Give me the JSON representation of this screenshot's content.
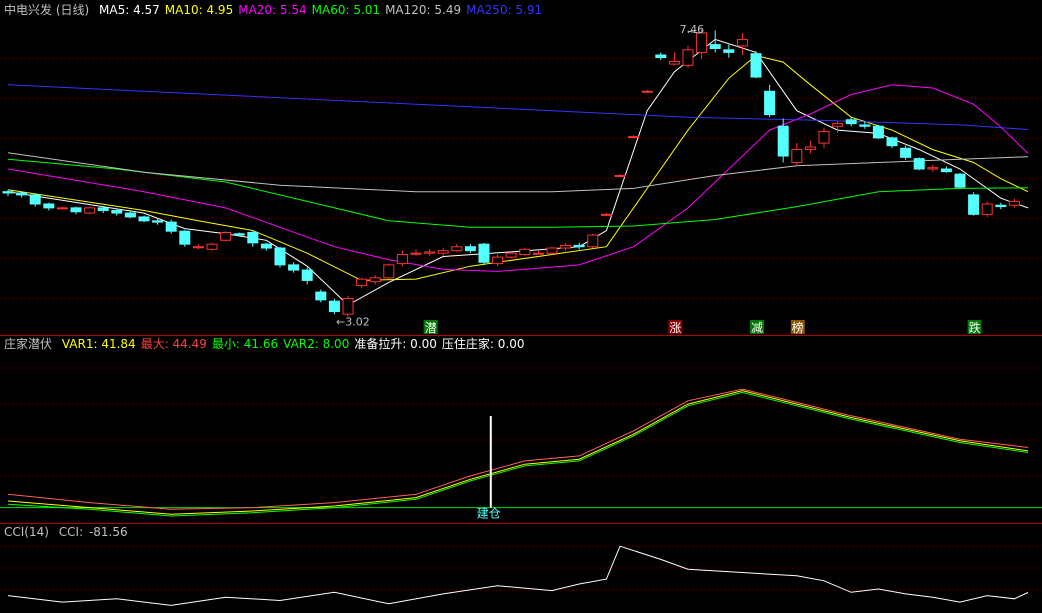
{
  "main_header": {
    "title": "中电兴发 (日线)",
    "ma": [
      {
        "label": "MA5:",
        "value": "4.57",
        "color": "#ffffff"
      },
      {
        "label": "MA10:",
        "value": "4.95",
        "color": "#ffff00"
      },
      {
        "label": "MA20:",
        "value": "5.54",
        "color": "#ff00ff"
      },
      {
        "label": "MA60:",
        "value": "5.01",
        "color": "#00ff00"
      },
      {
        "label": "MA120:",
        "value": "5.49",
        "color": "#c0c0c0"
      },
      {
        "label": "MA250:",
        "value": "5.91",
        "color": "#3333ff"
      }
    ]
  },
  "annotations": {
    "high": "7.46",
    "low": "3.02"
  },
  "signals": [
    {
      "label": "潜",
      "color": "#ffffff",
      "bg": "#007700"
    },
    {
      "label": "涨",
      "color": "#ffffff",
      "bg": "#880000"
    },
    {
      "label": "减",
      "color": "#ffffff",
      "bg": "#007700"
    },
    {
      "label": "榜",
      "color": "#ffffff",
      "bg": "#885500"
    },
    {
      "label": "跌",
      "color": "#ffffff",
      "bg": "#007700"
    }
  ],
  "ind1_header": {
    "name": "庄家潜伏",
    "items": [
      {
        "label": "VAR1:",
        "value": "41.84",
        "color": "#ffff00"
      },
      {
        "label": "最大:",
        "value": "44.49",
        "color": "#ff4040"
      },
      {
        "label": "最小:",
        "value": "41.66",
        "color": "#00ff00"
      },
      {
        "label": "VAR2:",
        "value": "8.00",
        "color": "#00ff00"
      },
      {
        "label": "准备拉升:",
        "value": "0.00",
        "color": "#ffffff"
      },
      {
        "label": "压住庄家:",
        "value": "0.00",
        "color": "#ffffff"
      }
    ],
    "marker": "建仓"
  },
  "ind2_header": {
    "name": "CCI(14)",
    "label": "CCI:",
    "value": "-81.56"
  },
  "chart_data": {
    "type": "candlestick",
    "price_range": [
      3.0,
      7.6
    ],
    "candles": [
      [
        4.95,
        4.98,
        4.88,
        4.93
      ],
      [
        4.93,
        4.95,
        4.86,
        4.9
      ],
      [
        4.9,
        4.92,
        4.72,
        4.76
      ],
      [
        4.76,
        4.78,
        4.66,
        4.7
      ],
      [
        4.7,
        4.72,
        4.68,
        4.7
      ],
      [
        4.7,
        4.72,
        4.6,
        4.64
      ],
      [
        4.62,
        4.72,
        4.6,
        4.7
      ],
      [
        4.7,
        4.72,
        4.62,
        4.66
      ],
      [
        4.66,
        4.68,
        4.58,
        4.62
      ],
      [
        4.62,
        4.64,
        4.54,
        4.56
      ],
      [
        4.56,
        4.58,
        4.48,
        4.5
      ],
      [
        4.5,
        4.54,
        4.44,
        4.48
      ],
      [
        4.48,
        4.52,
        4.3,
        4.34
      ],
      [
        4.34,
        4.36,
        4.1,
        4.14
      ],
      [
        4.1,
        4.14,
        4.06,
        4.1
      ],
      [
        4.06,
        4.16,
        4.04,
        4.14
      ],
      [
        4.2,
        4.34,
        4.18,
        4.32
      ],
      [
        4.3,
        4.32,
        4.26,
        4.28
      ],
      [
        4.32,
        4.36,
        4.1,
        4.16
      ],
      [
        4.14,
        4.16,
        4.04,
        4.08
      ],
      [
        4.08,
        4.1,
        3.78,
        3.82
      ],
      [
        3.82,
        3.86,
        3.7,
        3.74
      ],
      [
        3.74,
        3.78,
        3.52,
        3.58
      ],
      [
        3.4,
        3.44,
        3.24,
        3.28
      ],
      [
        3.26,
        3.3,
        3.06,
        3.1
      ],
      [
        3.06,
        3.34,
        3.02,
        3.3
      ],
      [
        3.5,
        3.62,
        3.46,
        3.6
      ],
      [
        3.56,
        3.66,
        3.52,
        3.62
      ],
      [
        3.62,
        3.84,
        3.6,
        3.82
      ],
      [
        3.84,
        4.04,
        3.8,
        3.98
      ],
      [
        4.0,
        4.06,
        3.96,
        4.0
      ],
      [
        4.0,
        4.06,
        3.96,
        4.02
      ],
      [
        4.0,
        4.08,
        3.96,
        4.04
      ],
      [
        4.04,
        4.14,
        4.02,
        4.1
      ],
      [
        4.1,
        4.14,
        4.0,
        4.04
      ],
      [
        4.14,
        4.16,
        3.82,
        3.86
      ],
      [
        3.84,
        3.98,
        3.8,
        3.94
      ],
      [
        3.94,
        4.02,
        3.92,
        4.0
      ],
      [
        3.98,
        4.08,
        3.96,
        4.06
      ],
      [
        4.0,
        4.04,
        3.98,
        4.0
      ],
      [
        4.0,
        4.1,
        3.98,
        4.08
      ],
      [
        4.08,
        4.16,
        4.04,
        4.12
      ],
      [
        4.12,
        4.16,
        4.06,
        4.1
      ],
      [
        4.1,
        4.3,
        4.08,
        4.28
      ],
      [
        4.6,
        4.62,
        4.58,
        4.6
      ],
      [
        5.2,
        5.22,
        5.18,
        5.2
      ],
      [
        5.8,
        5.82,
        5.78,
        5.8
      ],
      [
        6.5,
        6.52,
        6.48,
        6.5
      ],
      [
        7.06,
        7.1,
        6.98,
        7.02
      ],
      [
        6.92,
        7.1,
        6.9,
        6.96
      ],
      [
        6.9,
        7.2,
        6.86,
        7.14
      ],
      [
        7.1,
        7.46,
        7.0,
        7.4
      ],
      [
        7.22,
        7.44,
        7.1,
        7.16
      ],
      [
        7.14,
        7.22,
        7.02,
        7.1
      ],
      [
        7.2,
        7.4,
        7.06,
        7.3
      ],
      [
        7.08,
        7.12,
        6.7,
        6.72
      ],
      [
        6.5,
        6.6,
        6.1,
        6.14
      ],
      [
        5.96,
        6.08,
        5.4,
        5.5
      ],
      [
        5.4,
        5.7,
        5.36,
        5.6
      ],
      [
        5.6,
        5.74,
        5.54,
        5.64
      ],
      [
        5.7,
        5.94,
        5.62,
        5.88
      ],
      [
        5.96,
        6.04,
        5.86,
        6.0
      ],
      [
        6.06,
        6.1,
        5.96,
        6.0
      ],
      [
        5.98,
        6.04,
        5.92,
        5.96
      ],
      [
        5.96,
        5.98,
        5.76,
        5.78
      ],
      [
        5.78,
        5.8,
        5.62,
        5.66
      ],
      [
        5.62,
        5.66,
        5.44,
        5.48
      ],
      [
        5.46,
        5.48,
        5.28,
        5.3
      ],
      [
        5.3,
        5.36,
        5.26,
        5.32
      ],
      [
        5.3,
        5.34,
        5.24,
        5.26
      ],
      [
        5.22,
        5.24,
        5.0,
        5.02
      ],
      [
        4.9,
        4.94,
        4.58,
        4.6
      ],
      [
        4.6,
        4.8,
        4.56,
        4.76
      ],
      [
        4.74,
        4.78,
        4.68,
        4.72
      ],
      [
        4.74,
        4.84,
        4.7,
        4.8
      ]
    ],
    "ma_series": [
      {
        "name": "MA5",
        "color": "#ffffff",
        "points": [
          [
            0,
            4.95
          ],
          [
            10,
            4.62
          ],
          [
            13,
            4.38
          ],
          [
            16,
            4.3
          ],
          [
            19,
            4.2
          ],
          [
            22,
            3.8
          ],
          [
            25,
            3.2
          ],
          [
            28,
            3.55
          ],
          [
            32,
            3.95
          ],
          [
            37,
            4.02
          ],
          [
            42,
            4.1
          ],
          [
            44,
            4.35
          ],
          [
            47,
            6.2
          ],
          [
            49,
            6.8
          ],
          [
            52,
            7.3
          ],
          [
            55,
            7.1
          ],
          [
            58,
            6.2
          ],
          [
            61,
            5.9
          ],
          [
            64,
            5.85
          ],
          [
            67,
            5.6
          ],
          [
            70,
            5.3
          ],
          [
            73,
            4.85
          ],
          [
            75,
            4.7
          ]
        ]
      },
      {
        "name": "MA10",
        "color": "#ffff00",
        "points": [
          [
            0,
            4.98
          ],
          [
            10,
            4.66
          ],
          [
            14,
            4.5
          ],
          [
            18,
            4.35
          ],
          [
            22,
            4.0
          ],
          [
            26,
            3.58
          ],
          [
            30,
            3.6
          ],
          [
            34,
            3.8
          ],
          [
            40,
            3.98
          ],
          [
            44,
            4.1
          ],
          [
            47,
            5.0
          ],
          [
            50,
            5.9
          ],
          [
            53,
            6.7
          ],
          [
            55,
            7.05
          ],
          [
            57,
            6.95
          ],
          [
            59,
            6.6
          ],
          [
            62,
            6.1
          ],
          [
            65,
            5.9
          ],
          [
            68,
            5.6
          ],
          [
            71,
            5.4
          ],
          [
            73,
            5.15
          ],
          [
            75,
            4.95
          ]
        ]
      },
      {
        "name": "MA20",
        "color": "#ff00ff",
        "points": [
          [
            0,
            5.3
          ],
          [
            10,
            4.95
          ],
          [
            16,
            4.7
          ],
          [
            20,
            4.4
          ],
          [
            24,
            4.1
          ],
          [
            28,
            3.9
          ],
          [
            32,
            3.75
          ],
          [
            36,
            3.72
          ],
          [
            42,
            3.82
          ],
          [
            46,
            4.1
          ],
          [
            50,
            4.7
          ],
          [
            53,
            5.3
          ],
          [
            56,
            5.9
          ],
          [
            59,
            6.15
          ],
          [
            62,
            6.45
          ],
          [
            65,
            6.6
          ],
          [
            68,
            6.55
          ],
          [
            71,
            6.3
          ],
          [
            73,
            5.95
          ],
          [
            75,
            5.54
          ]
        ]
      },
      {
        "name": "MA60",
        "color": "#00ff00",
        "points": [
          [
            0,
            5.45
          ],
          [
            8,
            5.3
          ],
          [
            16,
            5.1
          ],
          [
            22,
            4.8
          ],
          [
            28,
            4.5
          ],
          [
            34,
            4.4
          ],
          [
            40,
            4.4
          ],
          [
            46,
            4.42
          ],
          [
            52,
            4.52
          ],
          [
            58,
            4.72
          ],
          [
            64,
            4.95
          ],
          [
            70,
            5.0
          ],
          [
            75,
            5.01
          ]
        ]
      },
      {
        "name": "MA120",
        "color": "#c0c0c0",
        "points": [
          [
            0,
            5.55
          ],
          [
            10,
            5.25
          ],
          [
            20,
            5.05
          ],
          [
            30,
            4.95
          ],
          [
            40,
            4.95
          ],
          [
            46,
            5.0
          ],
          [
            52,
            5.2
          ],
          [
            58,
            5.35
          ],
          [
            64,
            5.4
          ],
          [
            70,
            5.45
          ],
          [
            75,
            5.49
          ]
        ]
      },
      {
        "name": "MA250",
        "color": "#3333ff",
        "points": [
          [
            0,
            6.6
          ],
          [
            10,
            6.5
          ],
          [
            20,
            6.4
          ],
          [
            30,
            6.3
          ],
          [
            40,
            6.2
          ],
          [
            50,
            6.1
          ],
          [
            60,
            6.05
          ],
          [
            70,
            5.98
          ],
          [
            75,
            5.91
          ]
        ]
      }
    ],
    "ind1_range": [
      0,
      100
    ],
    "ind1_series": [
      {
        "name": "VAR1",
        "color": "#ffff00",
        "points": [
          [
            0,
            12
          ],
          [
            6,
            8
          ],
          [
            12,
            4
          ],
          [
            18,
            6
          ],
          [
            24,
            9
          ],
          [
            30,
            14
          ],
          [
            34,
            25
          ],
          [
            38,
            34
          ],
          [
            42,
            37
          ],
          [
            46,
            52
          ],
          [
            50,
            70
          ],
          [
            54,
            78
          ],
          [
            58,
            70
          ],
          [
            62,
            62
          ],
          [
            66,
            55
          ],
          [
            70,
            48
          ],
          [
            75,
            42
          ]
        ]
      },
      {
        "name": "最大",
        "color": "#ff6060",
        "points": [
          [
            0,
            16
          ],
          [
            6,
            11
          ],
          [
            12,
            7
          ],
          [
            18,
            8
          ],
          [
            24,
            11
          ],
          [
            30,
            16
          ],
          [
            34,
            27
          ],
          [
            38,
            36
          ],
          [
            42,
            39
          ],
          [
            46,
            54
          ],
          [
            50,
            72
          ],
          [
            54,
            79
          ],
          [
            58,
            71
          ],
          [
            62,
            63
          ],
          [
            66,
            56
          ],
          [
            70,
            49
          ],
          [
            75,
            44
          ]
        ]
      },
      {
        "name": "最小",
        "color": "#00ff00",
        "points": [
          [
            0,
            10
          ],
          [
            6,
            7
          ],
          [
            12,
            3
          ],
          [
            18,
            5
          ],
          [
            24,
            8
          ],
          [
            30,
            13
          ],
          [
            34,
            24
          ],
          [
            38,
            33
          ],
          [
            42,
            36
          ],
          [
            46,
            51
          ],
          [
            50,
            69
          ],
          [
            54,
            77
          ],
          [
            58,
            69
          ],
          [
            62,
            61
          ],
          [
            66,
            54
          ],
          [
            70,
            47
          ],
          [
            75,
            41
          ]
        ]
      }
    ],
    "ind1_baseline": 8.0,
    "ind2_range": [
      -200,
      250
    ],
    "cci": [
      [
        0,
        -100
      ],
      [
        4,
        -140
      ],
      [
        8,
        -120
      ],
      [
        12,
        -160
      ],
      [
        16,
        -110
      ],
      [
        20,
        -130
      ],
      [
        24,
        -80
      ],
      [
        28,
        -150
      ],
      [
        32,
        -90
      ],
      [
        36,
        -40
      ],
      [
        40,
        -70
      ],
      [
        42,
        -30
      ],
      [
        44,
        0
      ],
      [
        45,
        200
      ],
      [
        48,
        120
      ],
      [
        50,
        60
      ],
      [
        54,
        40
      ],
      [
        58,
        20
      ],
      [
        60,
        -10
      ],
      [
        62,
        -80
      ],
      [
        64,
        -60
      ],
      [
        66,
        -90
      ],
      [
        68,
        -110
      ],
      [
        70,
        -140
      ],
      [
        72,
        -100
      ],
      [
        74,
        -120
      ],
      [
        75,
        -81.56
      ]
    ]
  }
}
